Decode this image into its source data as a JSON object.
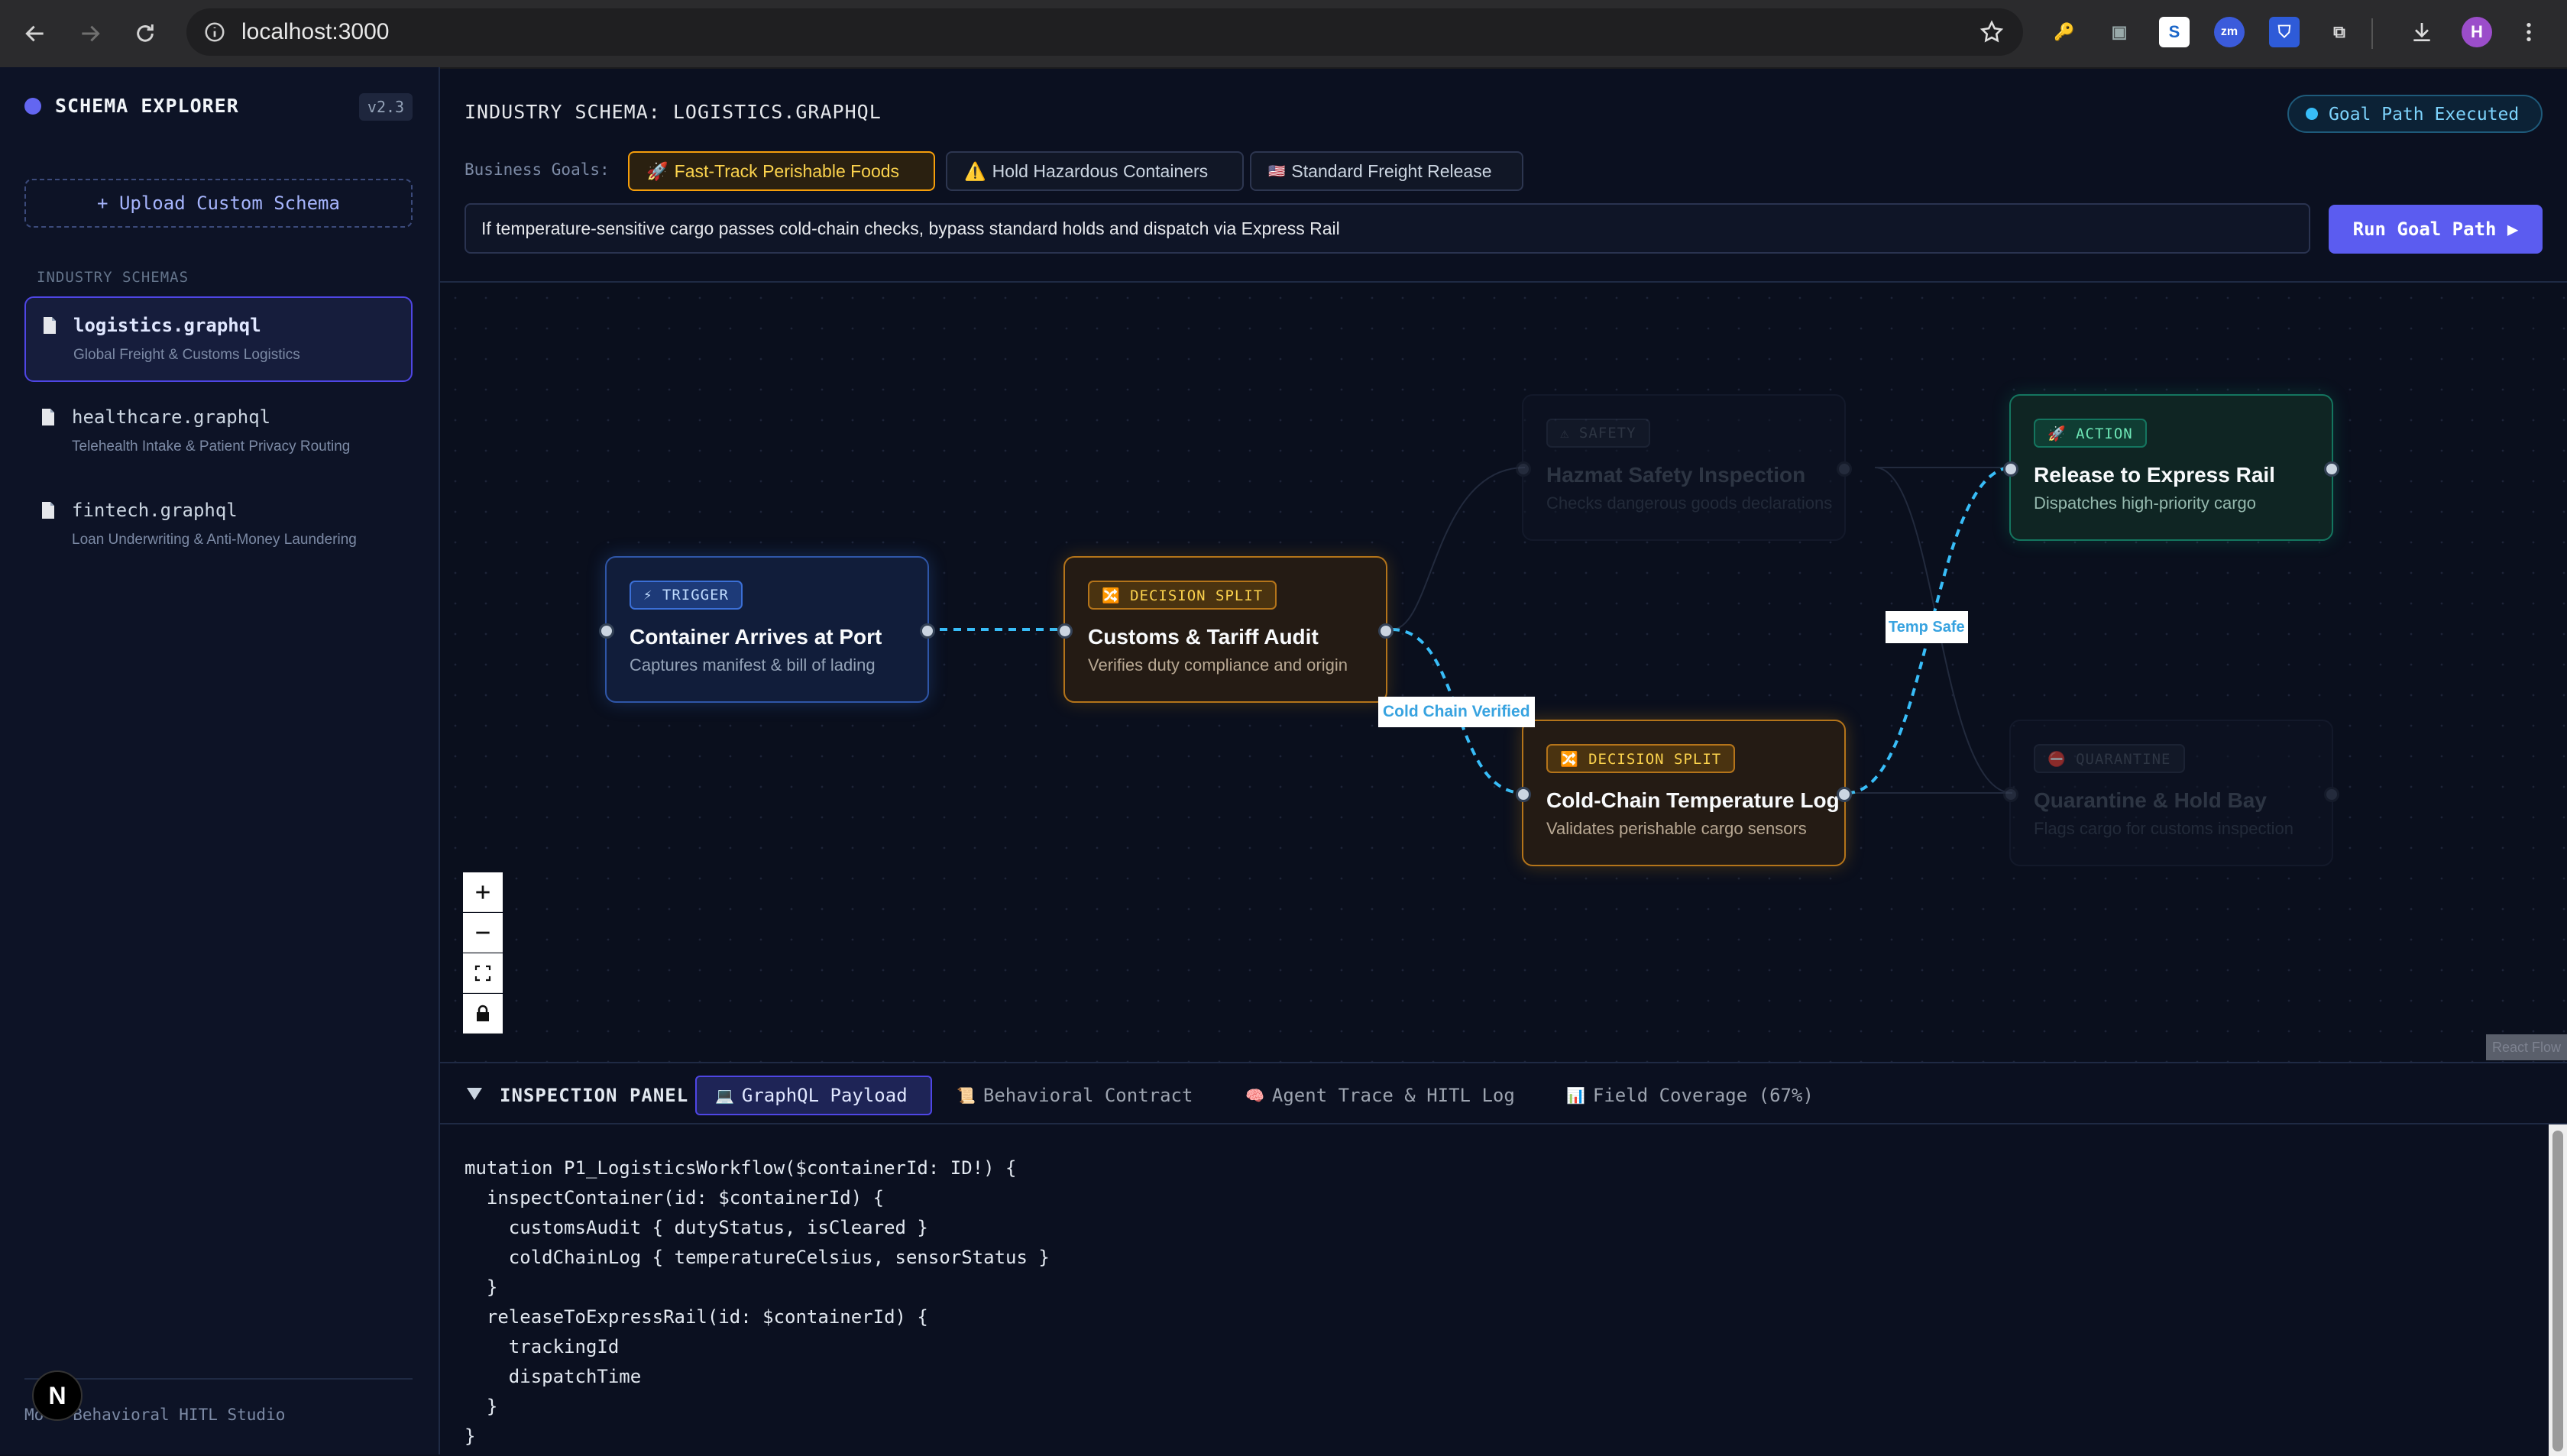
{
  "browser": {
    "url": "localhost:3000",
    "profile_initial": "H"
  },
  "sidebar": {
    "brand": "SCHEMA EXPLORER",
    "version": "v2.3",
    "upload_label": "+ Upload Custom Schema",
    "section_title": "INDUSTRY SCHEMAS",
    "items": [
      {
        "name": "logistics.graphql",
        "desc": "Global Freight & Customs Logistics"
      },
      {
        "name": "healthcare.graphql",
        "desc": "Telehealth Intake & Patient Privacy Routing"
      },
      {
        "name": "fintech.graphql",
        "desc": "Loan Underwriting & Anti-Money Laundering"
      }
    ],
    "footer": "Mo   Behavioral HITL Studio",
    "footer_badge": "N"
  },
  "header": {
    "title": "INDUSTRY SCHEMA: LOGISTICS.GRAPHQL",
    "status": "Goal Path Executed",
    "goals_label": "Business Goals:",
    "goals": [
      {
        "icon": "🚀",
        "label": "Fast-Track Perishable Foods"
      },
      {
        "icon": "⚠️",
        "label": "Hold Hazardous Containers"
      },
      {
        "icon": "🇺🇸",
        "label": "Standard Freight Release"
      }
    ],
    "goal_input": "If temperature-sensitive cargo passes cold-chain checks, bypass standard holds and dispatch via Express Rail",
    "run_button": "Run Goal Path ▶"
  },
  "flow": {
    "nodes": [
      {
        "id": "trigger",
        "tag": "⚡ TRIGGER",
        "title": "Container Arrives at Port",
        "sub": "Captures manifest & bill of lading"
      },
      {
        "id": "customs",
        "tag": "🔀 DECISION SPLIT",
        "title": "Customs & Tariff Audit",
        "sub": "Verifies duty compliance and origin"
      },
      {
        "id": "hazmat",
        "tag": "⚠ SAFETY",
        "title": "Hazmat Safety Inspection",
        "sub": "Checks dangerous goods declarations"
      },
      {
        "id": "coldchain",
        "tag": "🔀 DECISION SPLIT",
        "title": "Cold-Chain Temperature Log",
        "sub": "Validates perishable cargo sensors"
      },
      {
        "id": "release",
        "tag": "🚀 ACTION",
        "title": "Release to Express Rail",
        "sub": "Dispatches high-priority cargo"
      },
      {
        "id": "quarantine",
        "tag": "⛔ QUARANTINE",
        "title": "Quarantine & Hold Bay",
        "sub": "Flags cargo for customs inspection"
      }
    ],
    "edge_labels": [
      "Cold Chain Verified",
      "Temp Safe"
    ],
    "attribution": "React Flow"
  },
  "panel": {
    "title": "INSPECTION PANEL",
    "tabs": [
      {
        "icon": "💻",
        "label": "GraphQL Payload"
      },
      {
        "icon": "📜",
        "label": "Behavioral Contract"
      },
      {
        "icon": "🧠",
        "label": "Agent Trace & HITL Log"
      },
      {
        "icon": "📊",
        "label": "Field Coverage (67%)"
      }
    ],
    "code": "mutation P1_LogisticsWorkflow($containerId: ID!) {\n  inspectContainer(id: $containerId) {\n    customsAudit { dutyStatus, isCleared }\n    coldChainLog { temperatureCelsius, sensorStatus }\n  }\n  releaseToExpressRail(id: $containerId) {\n    trackingId\n    dispatchTime\n  }\n}"
  }
}
